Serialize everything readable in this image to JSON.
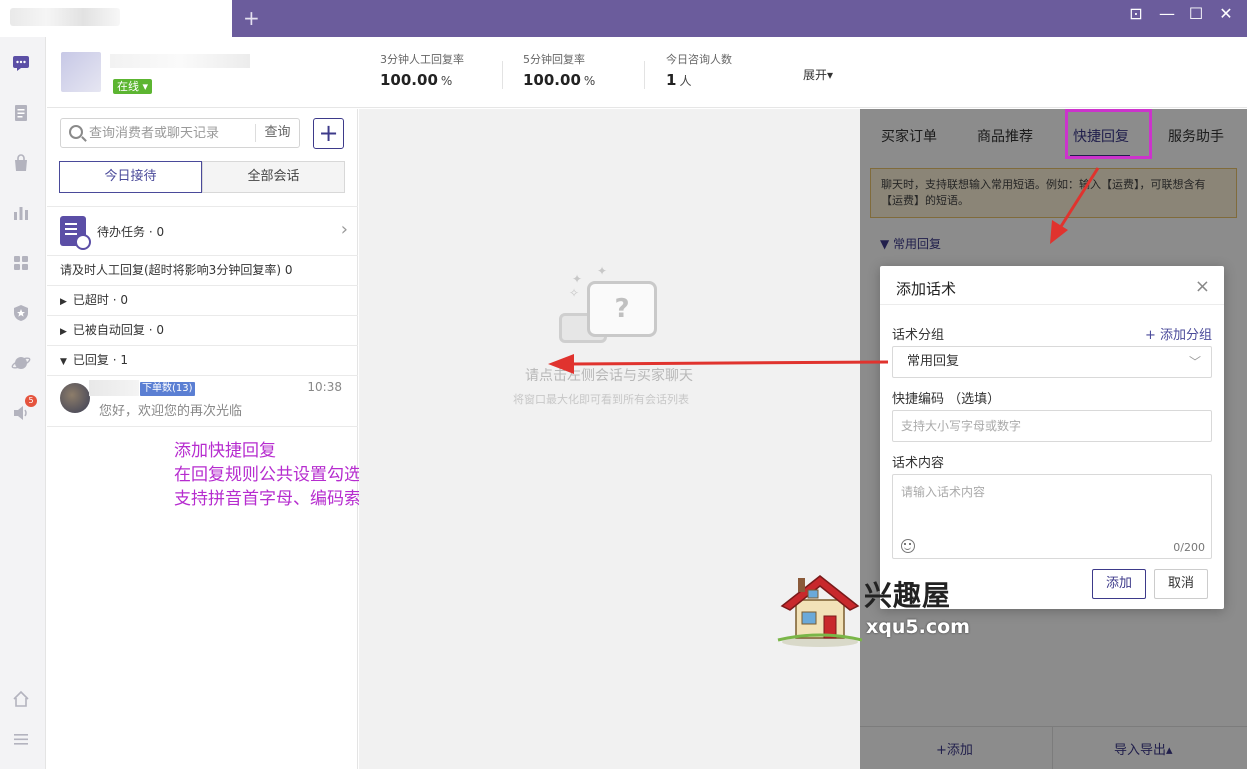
{
  "titlebar": {
    "add_tab": "+",
    "pin": "⊡",
    "minimize": "—",
    "maximize": "☐",
    "close": "✕"
  },
  "sidebar": {
    "badge": "5"
  },
  "header": {
    "status": "在线 ▾",
    "stats": [
      {
        "label": "3分钟人工回复率",
        "value": "100.00",
        "unit": "%"
      },
      {
        "label": "5分钟回复率",
        "value": "100.00",
        "unit": "%"
      },
      {
        "label": "今日咨询人数",
        "value": "1",
        "unit": "人"
      }
    ],
    "expand": "展开▾"
  },
  "convlist": {
    "search_placeholder": "查询消费者或聊天记录",
    "search_btn": "查询",
    "add": "+",
    "seg_today": "今日接待",
    "seg_all": "全部会话",
    "todo": "待办任务 · 0",
    "notice": "请及时人工回复(超时将影响3分钟回复率) 0",
    "groups": [
      "已超时 · 0",
      "已被自动回复 · 0",
      "已回复 · 1"
    ],
    "item": {
      "tag": "下单数(13)",
      "time": "10:38",
      "message": "您好，欢迎您的再次光临"
    }
  },
  "annotation": {
    "line1": "添加快捷回复",
    "line2": "在回复规则公共设置勾选，增强官方软件快捷回复（支持拼音首字母、编码索引）",
    "line3": "支持拼音首字母、编码索引大大提升客服手动回复效率"
  },
  "chat": {
    "empty_main": "请点击左侧会话与买家聊天",
    "empty_sub": "将窗口最大化即可看到所有会话列表"
  },
  "rightpanel": {
    "tabs": [
      "买家订单",
      "商品推荐",
      "快捷回复",
      "服务助手"
    ],
    "tip": "聊天时，支持联想输入常用短语。例如：输入【运费】，可联想含有【运费】的短语。",
    "group": "常用回复",
    "footer_add": "+添加",
    "footer_import": "导入导出▴"
  },
  "dialog": {
    "title": "添加话术",
    "group_label": "话术分组",
    "add_group": "+ 添加分组",
    "group_value": "常用回复",
    "code_label": "快捷编码 （选填）",
    "code_placeholder": "支持大小写字母或数字",
    "content_label": "话术内容",
    "content_placeholder": "请输入话术内容",
    "counter": "0/200",
    "ok": "添加",
    "cancel": "取消"
  },
  "watermark": {
    "name": "兴趣屋",
    "url": "xqu5.com"
  },
  "colors": {
    "accent": "#3d3a8a",
    "titlebar": "#6b5c9c",
    "annotation": "#b62ccf",
    "arrow": "#e0332e"
  }
}
